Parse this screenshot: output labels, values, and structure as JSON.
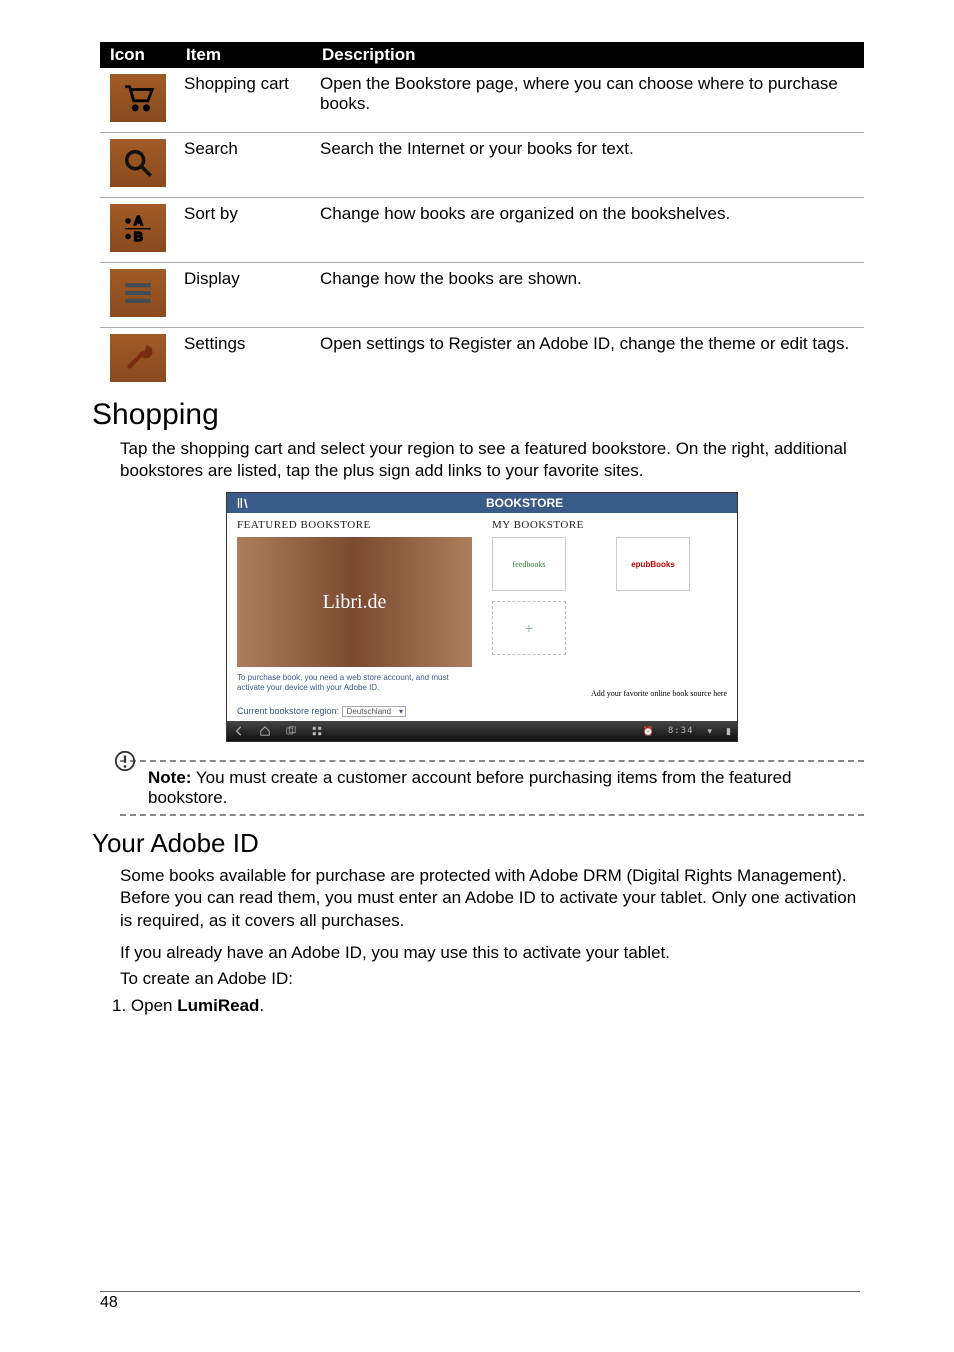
{
  "table": {
    "head": {
      "c0": "Icon",
      "c1": "Item",
      "c2": "Description"
    },
    "rows": [
      {
        "item": "Shopping cart",
        "desc": "Open the Bookstore page, where you can choose where to purchase books.",
        "icon": "cart-icon"
      },
      {
        "item": "Search",
        "desc": "Search the Internet or your books for text.",
        "icon": "search-icon"
      },
      {
        "item": "Sort by",
        "desc": "Change how books are organized on the bookshelves.",
        "icon": "sort-icon"
      },
      {
        "item": "Display",
        "desc": "Change how the books are shown.",
        "icon": "display-icon"
      },
      {
        "item": "Settings",
        "desc": "Open settings to Register an Adobe ID, change the theme or edit tags.",
        "icon": "settings-icon"
      }
    ]
  },
  "headings": {
    "shopping": "Shopping",
    "adobe": "Your Adobe ID"
  },
  "para": {
    "shopping": "Tap the shopping cart and select your region to see a featured bookstore. On the right, additional bookstores are listed, tap the plus sign add links to your favorite sites.",
    "adobe1": "Some books available for purchase are protected with Adobe DRM (Digital Rights Management). Before you can read them, you must enter an Adobe ID to activate your tablet. Only one activation is required, as it covers all purchases.",
    "adobe2": "If you already have an Adobe ID, you may use this to activate your tablet.",
    "adobe3": "To create an Adobe ID:"
  },
  "screenshot": {
    "title": "BOOKSTORE",
    "featured": "FEATURED BOOKSTORE",
    "mybookstore": "MY BOOKSTORE",
    "libri": "Libri.de",
    "note": "To purchase book, you need a web store account, and must activate your device with your Adobe ID.",
    "regionLabel": "Current bookstore region:",
    "regionValue": "Deutschland",
    "tile1": "feedbooks",
    "tile2": "epubBooks",
    "plus": "+",
    "addText": "Add your favorite online book source here",
    "clock": "8:34"
  },
  "note": {
    "label": "Note:",
    "text": " You must create a customer account before purchasing items from the featured bookstore."
  },
  "list": {
    "n1": "1.",
    "open": "Open ",
    "lumiread": "LumiRead",
    "dot": "."
  },
  "pageNum": "48"
}
